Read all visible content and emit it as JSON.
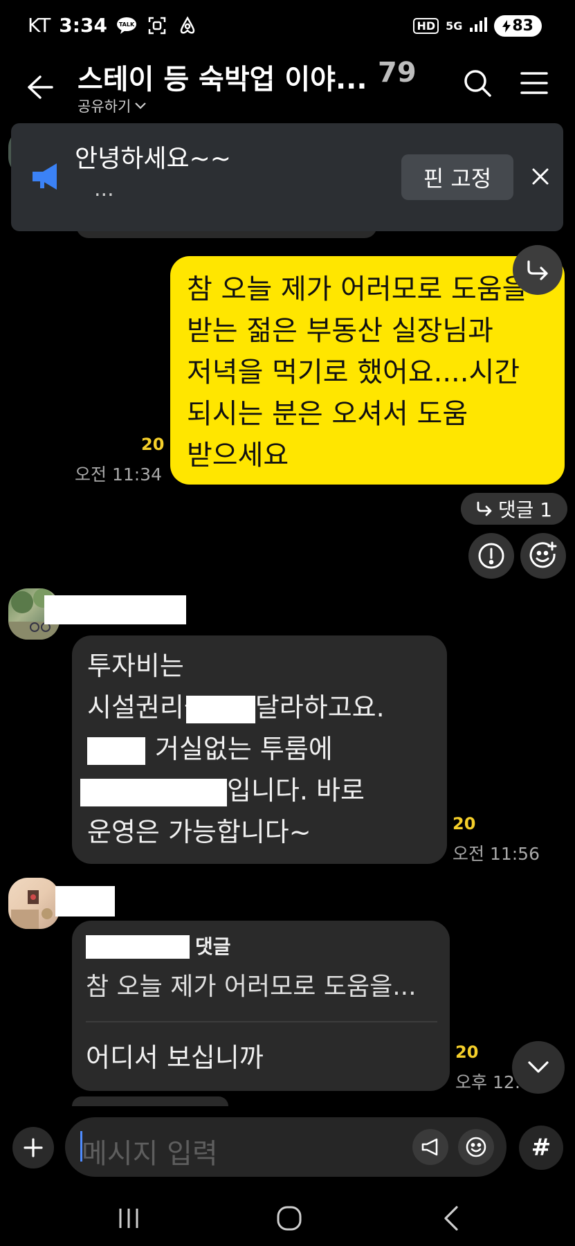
{
  "status_bar": {
    "carrier": "KT",
    "time": "3:34",
    "talk_badge": "TALK",
    "hd_badge": "HD",
    "network": "5G",
    "battery": "83",
    "colors": {
      "text": "#ffffff",
      "battery_bg": "#ffffff"
    }
  },
  "header": {
    "title": "스테이 등 숙박업 이야...",
    "member_count": "79",
    "share_label": "공유하기",
    "icons": [
      "back-arrow-icon",
      "search-icon",
      "menu-icon",
      "chevron-down-icon"
    ]
  },
  "notice": {
    "title": "안녕하세요~~",
    "subtitle": "...",
    "pin_button": "핀 고정",
    "icons": [
      "megaphone-icon",
      "close-icon"
    ],
    "accent": "#3b82f6"
  },
  "messages": [
    {
      "sender": "me",
      "lines": [
        "참 오늘 제가 어러모로 도움을",
        "받는 젊은 부동산 실장님과",
        "저녁을 먹기로 했어요....시간",
        "되시는 분은 오셔서 도움",
        "받으세요"
      ],
      "unread": "20",
      "time": "오전 11:34",
      "reply_chip": "댓글 1",
      "bubble_color": "#ffe600"
    },
    {
      "sender": "other-1",
      "lines": [
        "투자비는",
        "시설권리금",
        "달라하고요.",
        "거실없는 투룸에",
        "입니다. 바로",
        "운영은 가능합니다~"
      ],
      "unread": "20",
      "time": "오전 11:56"
    },
    {
      "sender": "other-2",
      "quote_label": "댓글",
      "quote_text": "참 오늘 제가 어러모로 도움을...",
      "text": "어디서 보십니까",
      "unread": "20",
      "time": "오후 12:..."
    }
  ],
  "input": {
    "placeholder": "메시지 입력",
    "hash": "#"
  }
}
